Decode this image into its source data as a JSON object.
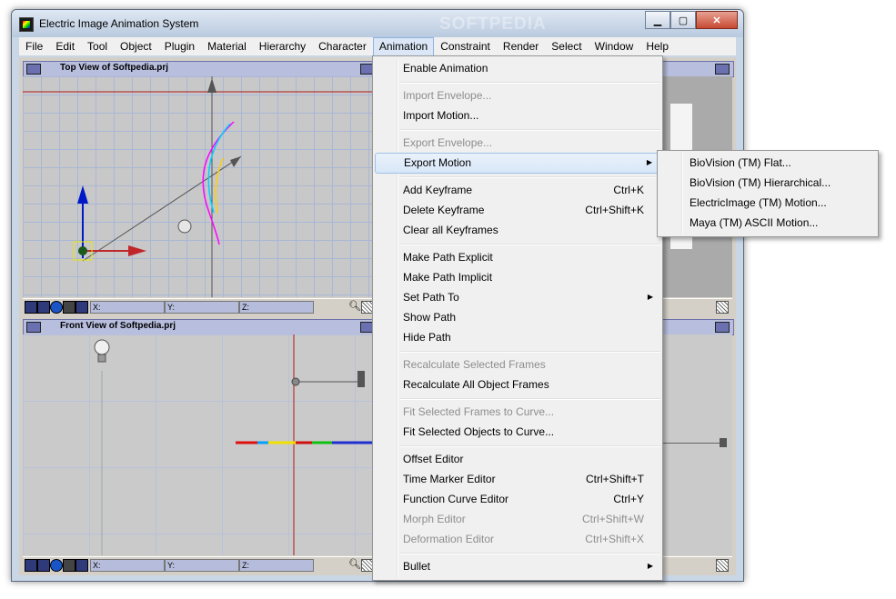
{
  "window": {
    "title": "Electric Image Animation System",
    "watermark": "SOFTPEDIA",
    "buttons": {
      "minimize": "▁",
      "maximize": "▢",
      "close": "✕"
    }
  },
  "menubar": [
    "File",
    "Edit",
    "Tool",
    "Object",
    "Plugin",
    "Material",
    "Hierarchy",
    "Character",
    "Animation",
    "Constraint",
    "Render",
    "Select",
    "Window",
    "Help"
  ],
  "viewports": {
    "top_title": "Top View of Softpedia.prj",
    "front_title": "Front View of Softpedia.prj",
    "coords": {
      "x": "X:",
      "y": "Y:",
      "z": "Z:"
    }
  },
  "animation_menu": {
    "items": [
      {
        "label": "Enable Animation",
        "shortcut": "",
        "disabled": false
      },
      {
        "label": "Import Envelope...",
        "shortcut": "",
        "disabled": true
      },
      {
        "label": "Import Motion...",
        "shortcut": "",
        "disabled": false
      },
      {
        "label": "Export Envelope...",
        "shortcut": "",
        "disabled": true
      },
      {
        "label": "Export Motion",
        "shortcut": "",
        "disabled": false,
        "submenu": true
      },
      {
        "label": "Add Keyframe",
        "shortcut": "Ctrl+K",
        "disabled": false
      },
      {
        "label": "Delete Keyframe",
        "shortcut": "Ctrl+Shift+K",
        "disabled": false
      },
      {
        "label": "Clear all Keyframes",
        "shortcut": "",
        "disabled": false
      },
      {
        "label": "Make Path Explicit",
        "shortcut": "",
        "disabled": false
      },
      {
        "label": "Make Path Implicit",
        "shortcut": "",
        "disabled": false
      },
      {
        "label": "Set Path To",
        "shortcut": "",
        "disabled": false,
        "submenu": true
      },
      {
        "label": "Show Path",
        "shortcut": "",
        "disabled": false
      },
      {
        "label": "Hide Path",
        "shortcut": "",
        "disabled": false
      },
      {
        "label": "Recalculate Selected Frames",
        "shortcut": "",
        "disabled": true
      },
      {
        "label": "Recalculate All Object Frames",
        "shortcut": "",
        "disabled": false
      },
      {
        "label": "Fit Selected Frames to Curve...",
        "shortcut": "",
        "disabled": true
      },
      {
        "label": "Fit Selected Objects to Curve...",
        "shortcut": "",
        "disabled": false
      },
      {
        "label": "Offset Editor",
        "shortcut": "",
        "disabled": false
      },
      {
        "label": "Time Marker Editor",
        "shortcut": "Ctrl+Shift+T",
        "disabled": false
      },
      {
        "label": "Function Curve Editor",
        "shortcut": "Ctrl+Y",
        "disabled": false
      },
      {
        "label": "Morph Editor",
        "shortcut": "Ctrl+Shift+W",
        "disabled": true
      },
      {
        "label": "Deformation Editor",
        "shortcut": "Ctrl+Shift+X",
        "disabled": true
      },
      {
        "label": "Bullet",
        "shortcut": "",
        "disabled": false,
        "submenu": true
      }
    ]
  },
  "export_motion_submenu": [
    "BioVision (TM) Flat...",
    "BioVision (TM) Hierarchical...",
    "ElectricImage (TM) Motion...",
    "Maya (TM) ASCII Motion..."
  ],
  "colors": {
    "menu_highlight": "#d8e7f8",
    "viewport_title": "#b8bede",
    "grid": "#a9b7d6",
    "axis_red": "#c0262a"
  }
}
